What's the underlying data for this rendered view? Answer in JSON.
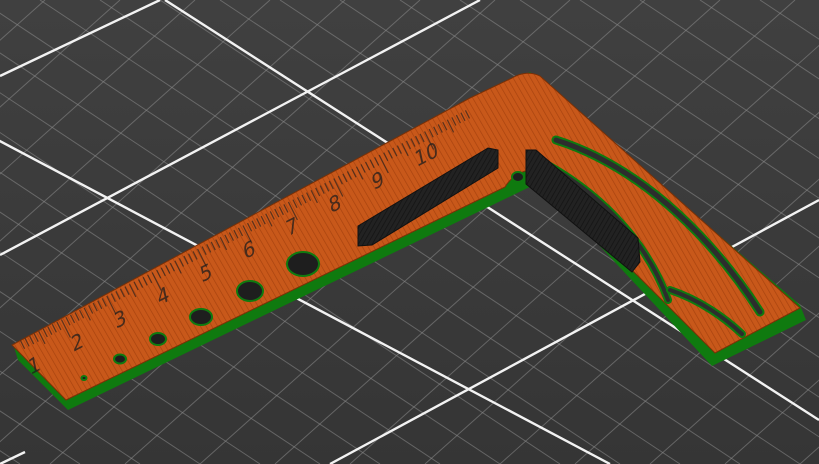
{
  "viewport": {
    "background": "#3a3a3a",
    "grid_minor_color": "#8c8c8c",
    "grid_major_color": "#f2f2f2"
  },
  "model": {
    "body_color": "#c8581a",
    "edge_color": "#0f7a0f",
    "rib_color": "#1f1f1f",
    "ruler_numbers": [
      "1",
      "2",
      "3",
      "4",
      "5",
      "6",
      "7",
      "8",
      "9",
      "10"
    ]
  }
}
